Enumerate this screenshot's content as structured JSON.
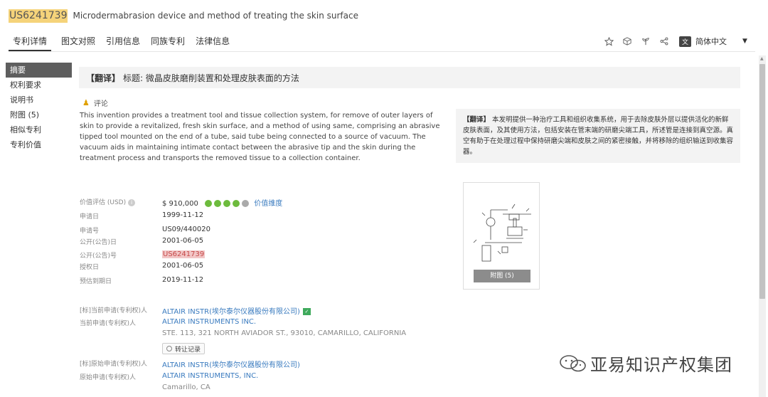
{
  "header": {
    "patent_number": "US6241739",
    "title": "Microdermabrasion device and method of treating the skin surface"
  },
  "tabs": [
    "专利详情",
    "图文对照",
    "引用信息",
    "同族专利",
    "法律信息"
  ],
  "toolbar": {
    "icons": [
      "star-icon",
      "cube-icon",
      "plant-icon",
      "share-icon"
    ],
    "language": "简体中文",
    "language_badge": "文"
  },
  "sidebar": {
    "items": [
      "摘要",
      "权利要求",
      "说明书",
      "附图 (5)",
      "相似专利",
      "专利价值"
    ]
  },
  "translated_title": {
    "tag": "【翻译】",
    "text": "标题: 微晶皮肤磨削装置和处理皮肤表面的方法"
  },
  "review": {
    "icon": "reviewer-icon",
    "label": "评论"
  },
  "abstract": {
    "text": "This invention provides a treatment tool and tissue collection system, for remove of outer layers of skin to provide a revitalized, fresh skin surface, and a method of using same, comprising an abrasive tipped tool mounted on the end of a tube, said tube being connected to a source of vacuum. The vacuum aids in maintaining intimate contact between the abrasive tip and the skin during the treatment process and transports the removed tissue to a collection container."
  },
  "abstract_translation": {
    "tag": "【翻译】",
    "text": "本发明提供一种治疗工具和组织收集系统，用于去除皮肤外层以提供活化的新鲜皮肤表面，及其使用方法，包括安装在管末端的研磨尖端工具，所述管是连接到真空源。真空有助于在处理过程中保持研磨尖端和皮肤之间的紧密接触，并将移除的组织输送到收集容器。"
  },
  "fields": {
    "value_label": "价值评估 (USD)",
    "value": "$ 910,000",
    "value_dots": [
      1,
      2,
      3,
      4,
      5
    ],
    "value_dot_active": 4,
    "value_link": "价值维度",
    "app_date_label": "申请日",
    "app_date": "1999-11-12",
    "app_no_label": "申请号",
    "app_no": "US09/440020",
    "pub_date_label": "公开(公告)日",
    "pub_date": "2001-06-05",
    "pub_no_label": "公开(公告)号",
    "pub_no": "US6241739",
    "grant_date_label": "授权日",
    "grant_date": "2001-06-05",
    "expiry_label": "预估到期日",
    "expiry": "2019-11-12",
    "std_assignee_label": "[标]当前申请(专利权)人",
    "std_assignee": "ALTAIR INSTR(埃尔泰尔仪器股份有限公司)",
    "cur_assignee_label": "当前申请(专利权)人",
    "cur_assignee": "ALTAIR INSTRUMENTS INC.",
    "cur_address": "STE. 113, 321 NORTH AVIADOR ST., 93010, CAMARILLO, CALIFORNIA",
    "change_btn": "转让记录",
    "orig_std_assignee_label": "[标]原始申请(专利权)人",
    "orig_std_assignee": "ALTAIR INSTR(埃尔泰尔仪器股份有限公司)",
    "orig_assignee_label": "原始申请(专利权)人",
    "orig_assignee": "ALTAIR INSTRUMENTS, INC.",
    "orig_location": "Camarillo, CA"
  },
  "figure": {
    "button": "附图 (5)"
  },
  "watermark": {
    "text": "亚易知识产权集团"
  }
}
